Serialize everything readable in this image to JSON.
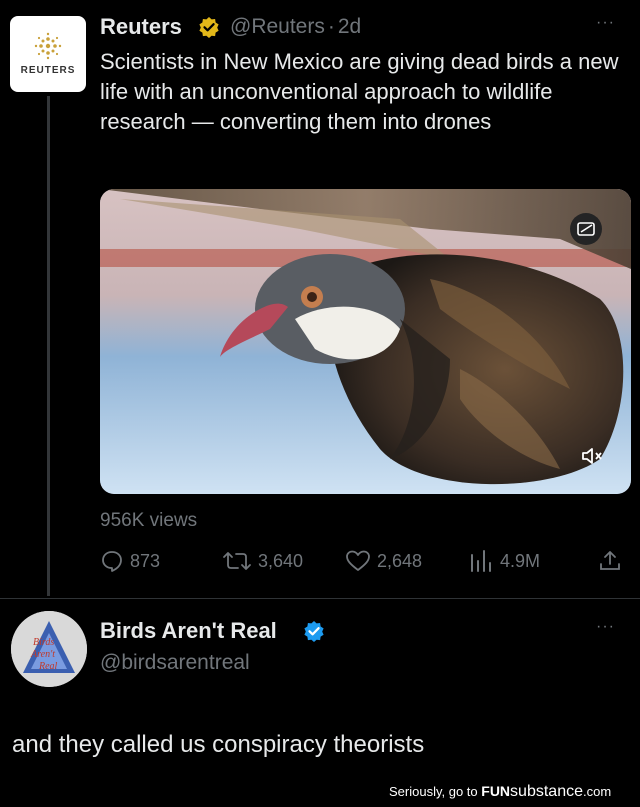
{
  "tweet": {
    "author_name": "Reuters",
    "handle": "@Reuters",
    "separator": "·",
    "age": "2d",
    "avatar_word": "REUTERS",
    "text": "Scientists in New Mexico are giving dead birds a new life with an unconventional approach to wildlife research — converting them into drones",
    "views": "956K views",
    "more": "···",
    "actions": {
      "replies": "873",
      "reposts": "3,640",
      "likes": "2,648",
      "views": "4.9M"
    }
  },
  "reply": {
    "author_name": "Birds Aren't Real",
    "handle": "@birdsarentreal",
    "avatar_text": "Birds Aren't Real",
    "more": "···",
    "text": "and they called us conspiracy theorists"
  },
  "footer": {
    "prefix": "Seriously, go to",
    "brand_a": "FUN",
    "brand_b": "substance",
    "brand_c": ".com"
  },
  "colors": {
    "background": "#000000",
    "text": "#e7e9ea",
    "muted": "#71767b",
    "gold_badge": "#e2b719",
    "blue_badge": "#1d9bf0"
  }
}
